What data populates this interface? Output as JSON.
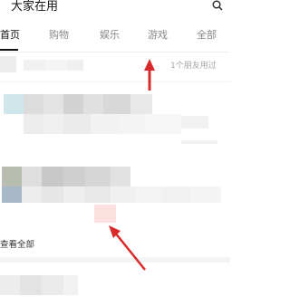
{
  "header": {
    "title": "大家在用"
  },
  "tabs": [
    {
      "label": "首页",
      "active": true
    },
    {
      "label": "购物",
      "active": false
    },
    {
      "label": "娱乐",
      "active": false
    },
    {
      "label": "游戏",
      "active": false
    },
    {
      "label": "全部",
      "active": false
    }
  ],
  "content": {
    "friends_used": "1个朋友用过",
    "see_all": "查看全部"
  },
  "colors": {
    "annotation_arrow": "#d92b2b",
    "active_tab": "#111111",
    "inactive_tab": "#888888"
  }
}
